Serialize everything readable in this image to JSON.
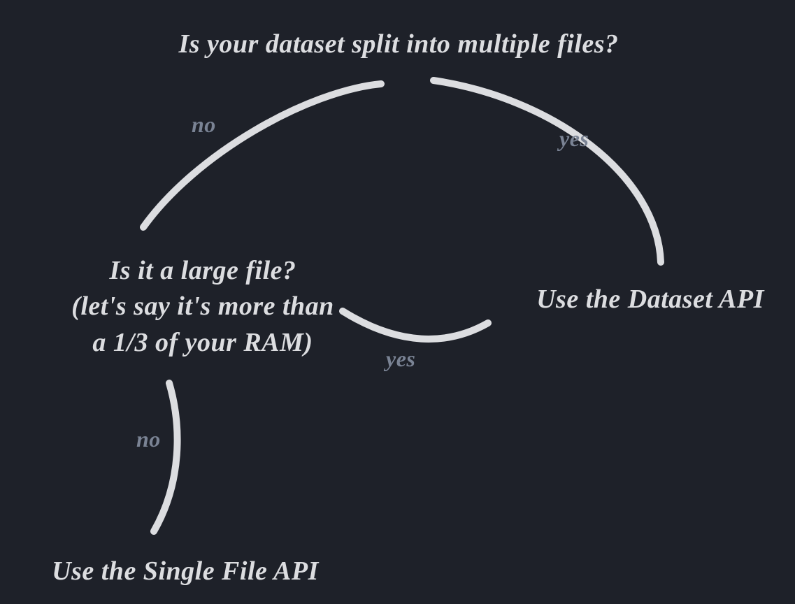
{
  "nodes": {
    "question1": "Is your dataset split into multiple files?",
    "question2_line1": "Is it a large file?",
    "question2_line2": "(let's say it's more than",
    "question2_line3": "a 1/3 of your RAM)",
    "result_dataset": "Use the Dataset API",
    "result_single": "Use the Single File API"
  },
  "labels": {
    "no1": "no",
    "yes1": "yes",
    "yes2": "yes",
    "no2": "no"
  }
}
